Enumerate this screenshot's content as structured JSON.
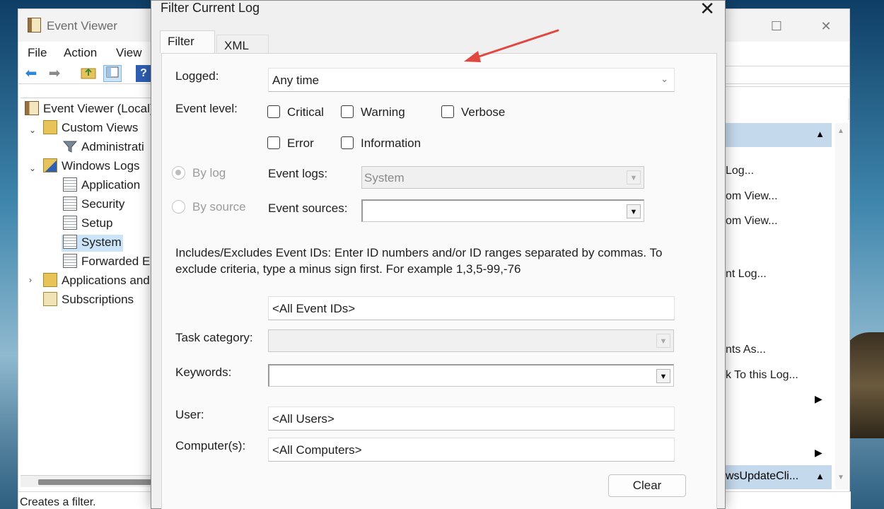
{
  "main_window": {
    "title": "Event Viewer",
    "menu": [
      "File",
      "Action",
      "View"
    ],
    "controls": {
      "maximize": "☐",
      "close": "✕"
    },
    "tree": {
      "root": "Event Viewer (Local)",
      "custom_views": "Custom Views",
      "administrative": "Administrati",
      "windows_logs": "Windows Logs",
      "application": "Application",
      "security": "Security",
      "setup": "Setup",
      "system": "System",
      "forwarded": "Forwarded E",
      "applications_and": "Applications and",
      "subscriptions": "Subscriptions"
    },
    "actions_pane": [
      "Log...",
      "om View...",
      "om View...",
      "nt Log...",
      "nts As...",
      "k To this Log...",
      "wsUpdateCli..."
    ],
    "status": "Creates a filter."
  },
  "dialog": {
    "title": "Filter Current Log",
    "close_glyph": "✕",
    "tabs": {
      "filter": "Filter",
      "xml": "XML"
    },
    "logged": {
      "label": "Logged:",
      "value": "Any time",
      "chevron": "⌄"
    },
    "event_level": {
      "label": "Event level:",
      "critical": "Critical",
      "warning": "Warning",
      "verbose": "Verbose",
      "error": "Error",
      "information": "Information"
    },
    "by_log": "By log",
    "by_source": "By source",
    "event_logs": {
      "label": "Event logs:",
      "value": "System"
    },
    "event_sources": {
      "label": "Event sources:",
      "value": ""
    },
    "description": "Includes/Excludes Event IDs: Enter ID numbers and/or ID ranges separated by commas. To exclude criteria, type a minus sign first. For example 1,3,5-99,-76",
    "event_ids": {
      "value": "<All Event IDs>"
    },
    "task_category": {
      "label": "Task category:",
      "value": ""
    },
    "keywords": {
      "label": "Keywords:",
      "value": ""
    },
    "user": {
      "label": "User:",
      "value": "<All Users>"
    },
    "computers": {
      "label": "Computer(s):",
      "value": "<All Computers>"
    },
    "clear_button": "Clear",
    "dropdown_glyph": "▼"
  },
  "colors": {
    "annotation_arrow": "#e0473e",
    "selection": "#cce4f7",
    "actions_header": "#c4d9ec"
  }
}
